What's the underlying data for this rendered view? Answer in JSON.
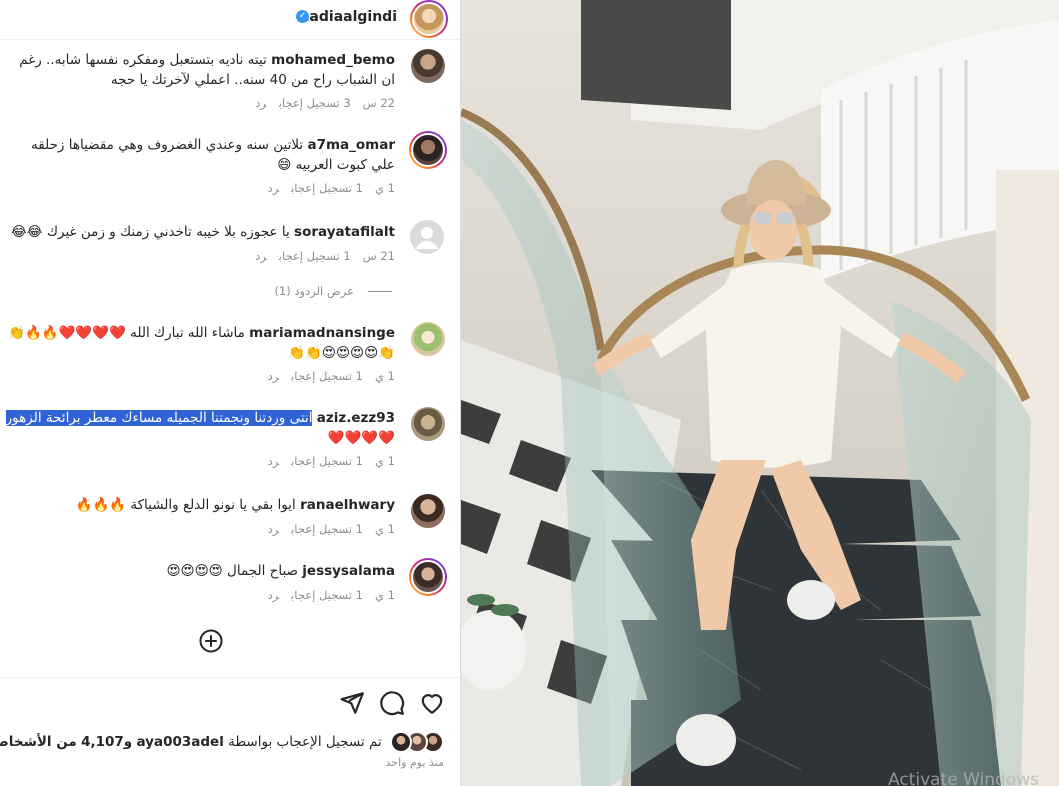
{
  "post": {
    "username": "nadiaalgindi",
    "verified": true
  },
  "comments": [
    {
      "user": "mohamed_bemo",
      "text": "تيته ناديه بتستعبل ومفكره نفسها شابه.. رغم ان الشباب راح من 40 سنه.. اعملي لآخرتك يا حجه",
      "time": "22 س",
      "likes": "3 تسجيل إعجاب",
      "reply": "رد"
    },
    {
      "user": "a7ma_omar",
      "text": "تلاتين سنه وعندي الغضروف وهي مقضياها زحلقه علي كبوت العربيه 😄",
      "time": "1 ي",
      "likes": "1 تسجيل إعجاب",
      "reply": "رد"
    },
    {
      "user": "sorayatafilalt",
      "text": "يا عجوزه بلا خيبه تاخدني زمنك و زمن غيرك 😂😂",
      "time": "21 س",
      "likes": "1 تسجيل إعجاب",
      "reply": "رد"
    },
    {
      "user": "mariamadnansinge",
      "text": "ماشاء الله تبارك الله ❤️❤️❤️❤️🔥🔥👏👏😍😍😍😍👏👏",
      "time": "1 ي",
      "likes": "1 تسجيل إعجاب",
      "reply": "رد"
    },
    {
      "user": "aziz.ezz93",
      "text": "انتى وردتنا ونجمتنا الجميله مساءك معطر برائحة الزهور",
      "text2": "❤️❤️❤️❤️",
      "time": "1 ي",
      "likes": "1 تسجيل إعجاب",
      "reply": "رد"
    },
    {
      "user": "ranaelhwary",
      "text": "ايوا بقي يا نونو الدلع والشياكة 🔥🔥🔥",
      "time": "1 ي",
      "likes": "1 تسجيل إعجاب",
      "reply": "رد"
    },
    {
      "user": "jessysalama",
      "text": "صباح الجمال 😍😍😍😍",
      "time": "1 ي",
      "likes": "1 تسجيل إعجاب",
      "reply": "رد"
    }
  ],
  "view_replies": "عرض الردود (1)",
  "likes_summary": {
    "prefix": "تم تسجيل الإعجاب بواسطة",
    "liker": "aya003adel",
    "middle": "و4,107",
    "suffix": "من الأشخاص الآخرين"
  },
  "time_ago": "منذ يوم واحد",
  "watermark": "Activate Windows",
  "icons": {
    "like": "heart-icon",
    "comment": "comment-icon",
    "share": "send-icon",
    "add": "add-circle-icon",
    "verified": "verified-badge-icon"
  },
  "colors": {
    "selection": "#3063d8",
    "verified": "#3897f0",
    "muted": "#8e8e8e"
  }
}
